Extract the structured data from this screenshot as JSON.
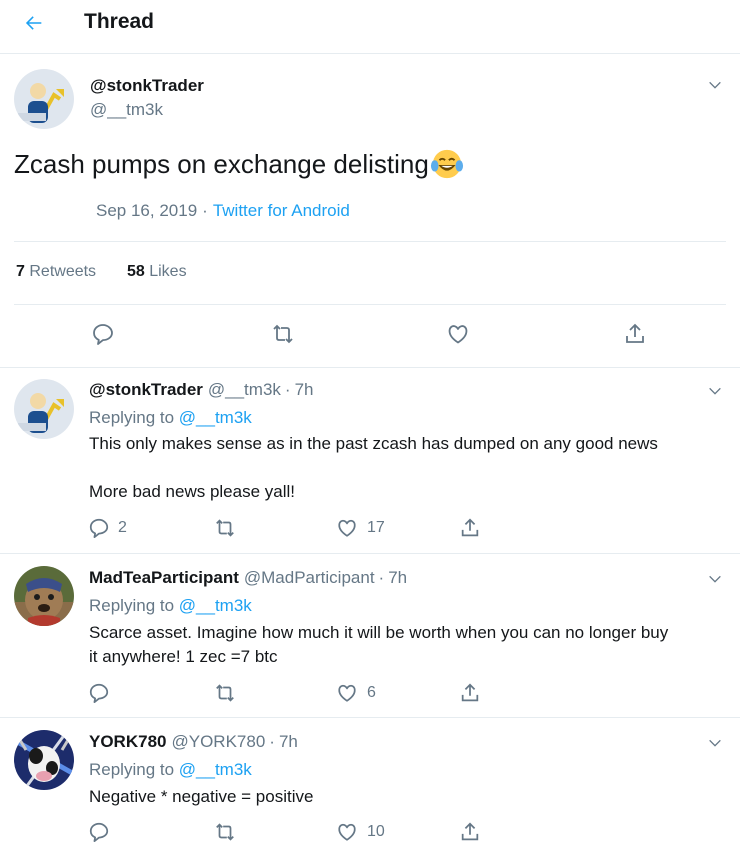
{
  "header": {
    "title": "Thread"
  },
  "main_tweet": {
    "name": "@stonkTrader",
    "handle": "@__tm3k",
    "text": "Zcash pumps on exchange delisting",
    "date": "Sep 16, 2019",
    "separator": "·",
    "source": "Twitter for Android",
    "retweets_count": "7",
    "retweets_label": "Retweets",
    "likes_count": "58",
    "likes_label": "Likes"
  },
  "replies": [
    {
      "name": "@stonkTrader",
      "handle": "@__tm3k",
      "dot": "·",
      "time": "7h",
      "replying_label": "Replying to",
      "replying_to": "@__tm3k",
      "text_line1": "This only makes sense as in the past zcash has dumped on any good news",
      "text_line2": "More bad news please yall!",
      "reply_count": "2",
      "retweet_count": "",
      "like_count": "17"
    },
    {
      "name": "MadTeaParticipant",
      "handle": "@MadParticipant",
      "dot": "·",
      "time": "7h",
      "replying_label": "Replying to",
      "replying_to": "@__tm3k",
      "text_line1": "Scarce asset. Imagine how much it will be worth when you can no longer buy",
      "text_line2": "it anywhere! 1 zec =7 btc",
      "reply_count": "",
      "retweet_count": "",
      "like_count": "6"
    },
    {
      "name": "YORK780",
      "handle": "@YORK780",
      "dot": "·",
      "time": "7h",
      "replying_label": "Replying to",
      "replying_to": "@__tm3k",
      "text_line1": "Negative * negative = positive",
      "reply_count": "",
      "retweet_count": "",
      "like_count": "10"
    }
  ],
  "colors": {
    "accent": "#1da1f2",
    "muted": "#657786",
    "text": "#14171a",
    "border": "#e6ecf0"
  },
  "icons": [
    "back-arrow-icon",
    "chevron-down-icon",
    "reply-icon",
    "retweet-icon",
    "like-heart-icon",
    "share-icon",
    "tears-of-joy-emoji"
  ]
}
